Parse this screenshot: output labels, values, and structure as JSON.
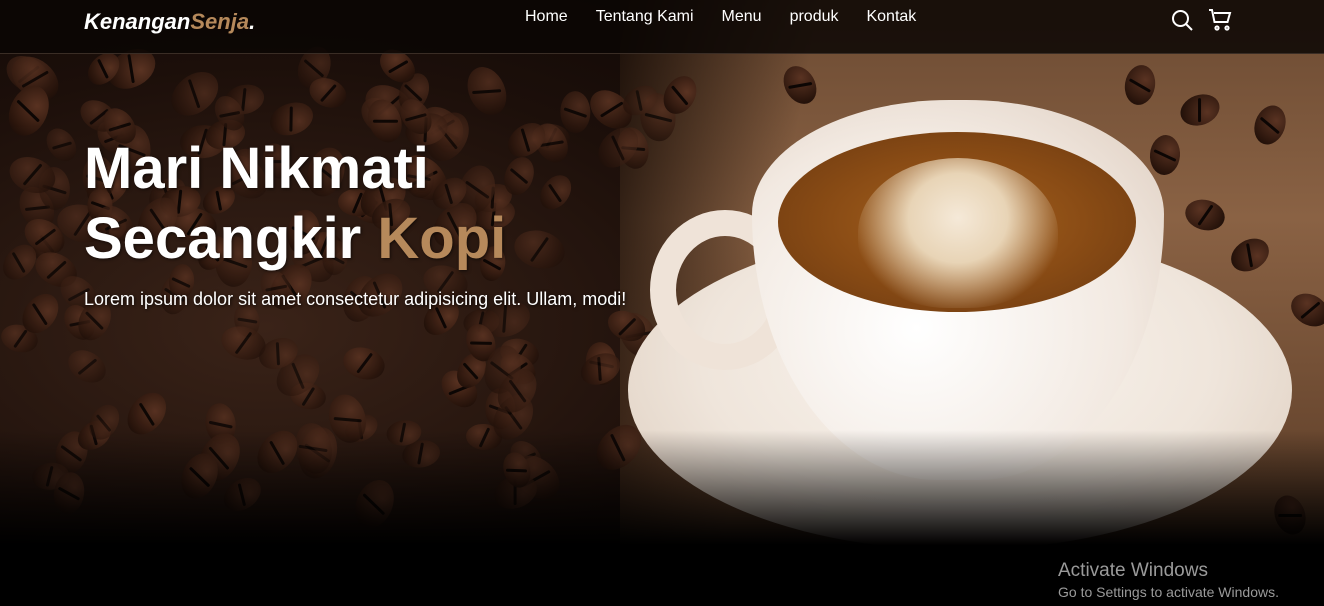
{
  "navbar": {
    "logo_main": "Kenangan",
    "logo_accent": "Senja",
    "logo_dot": ".",
    "links": [
      "Home",
      "Tentang Kami",
      "Menu",
      "produk",
      "Kontak"
    ],
    "icons": [
      "search-icon",
      "cart-icon"
    ]
  },
  "hero": {
    "headline_line1": "Mari Nikmati",
    "headline_line2_main": "Secangkir ",
    "headline_line2_accent": "Kopi",
    "description": "Lorem ipsum dolor sit amet consectetur adipisicing elit. Ullam, modi!"
  },
  "watermark": {
    "title": "Activate Windows",
    "subtitle": "Go to Settings to activate Windows."
  },
  "colors": {
    "accent": "#b6895b",
    "background": "#000000",
    "text": "#ffffff"
  }
}
